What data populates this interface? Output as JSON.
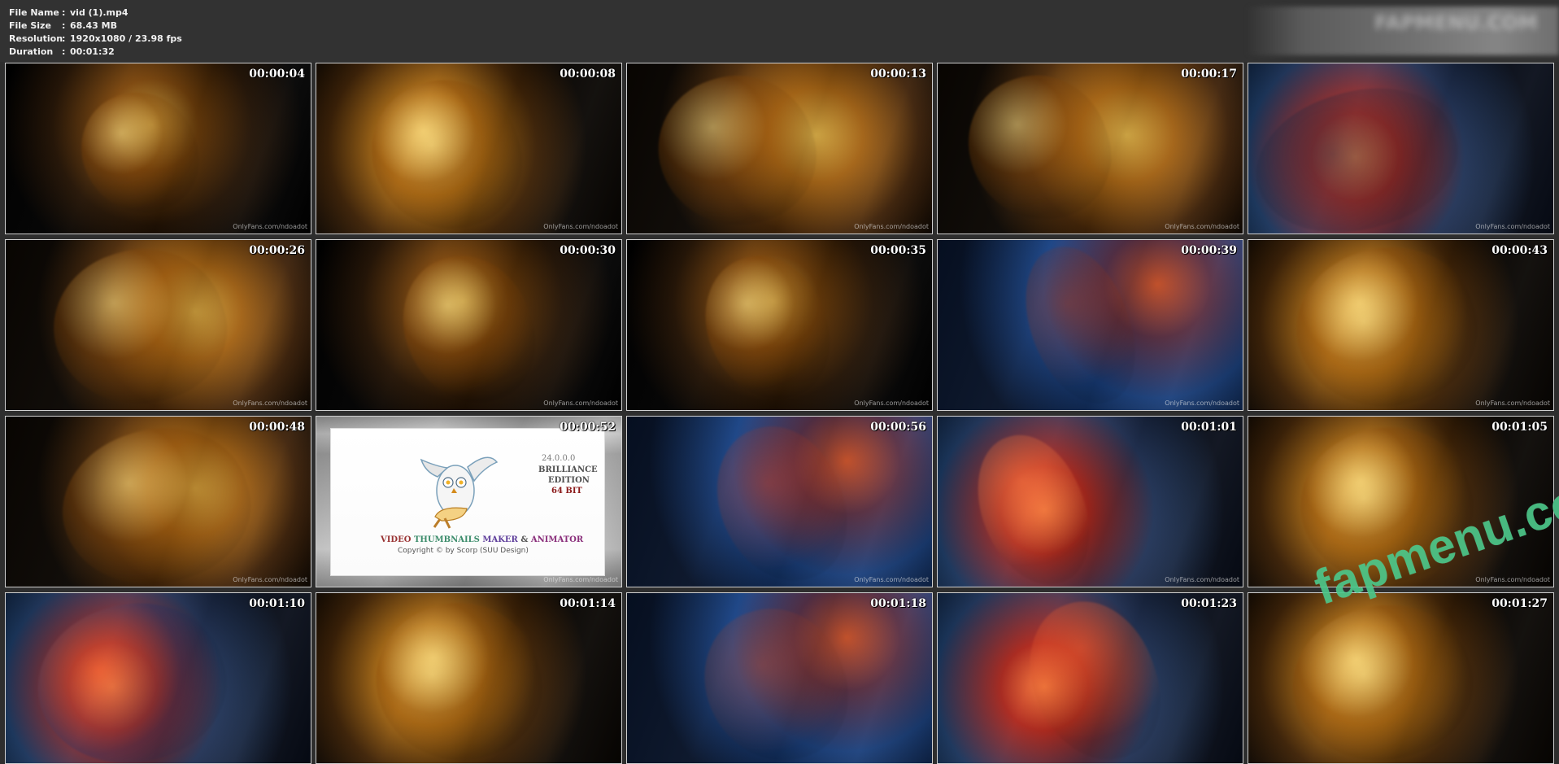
{
  "header": {
    "info": [
      {
        "label": "File Name",
        "sep": ":",
        "value": "vid (1).mp4"
      },
      {
        "label": "File Size",
        "sep": ":",
        "value": "68.43 MB"
      },
      {
        "label": "Resolution",
        "sep": ":",
        "value": "1920x1080 / 23.98 fps"
      },
      {
        "label": "Duration",
        "sep": ":",
        "value": "00:01:32"
      }
    ]
  },
  "thumbnails": [
    {
      "time": "00:00:04",
      "style": "dark",
      "watermark": "OnlyFans.com/ndoadot"
    },
    {
      "time": "00:00:08",
      "style": "warm2",
      "watermark": "OnlyFans.com/ndoadot"
    },
    {
      "time": "00:00:13",
      "style": "warm",
      "watermark": "OnlyFans.com/ndoadot"
    },
    {
      "time": "00:00:17",
      "style": "warm",
      "watermark": "OnlyFans.com/ndoadot"
    },
    {
      "time": "",
      "style": "red",
      "watermark": "OnlyFans.com/ndoadot"
    },
    {
      "time": "00:00:26",
      "style": "warm",
      "watermark": "OnlyFans.com/ndoadot"
    },
    {
      "time": "00:00:30",
      "style": "dark",
      "watermark": "OnlyFans.com/ndoadot"
    },
    {
      "time": "00:00:35",
      "style": "dark",
      "watermark": "OnlyFans.com/ndoadot"
    },
    {
      "time": "00:00:39",
      "style": "blue",
      "watermark": "OnlyFans.com/ndoadot"
    },
    {
      "time": "00:00:43",
      "style": "warm2",
      "watermark": "OnlyFans.com/ndoadot"
    },
    {
      "time": "00:00:48",
      "style": "warm",
      "watermark": "OnlyFans.com/ndoadot"
    },
    {
      "time": "00:00:52",
      "style": "splash",
      "watermark": "OnlyFans.com/ndoadot"
    },
    {
      "time": "00:00:56",
      "style": "blue",
      "watermark": "OnlyFans.com/ndoadot"
    },
    {
      "time": "00:01:01",
      "style": "red",
      "watermark": "OnlyFans.com/ndoadot"
    },
    {
      "time": "00:01:05",
      "style": "warm2",
      "watermark": "OnlyFans.com/ndoadot"
    },
    {
      "time": "00:01:10",
      "style": "red",
      "watermark": ""
    },
    {
      "time": "00:01:14",
      "style": "warm2",
      "watermark": ""
    },
    {
      "time": "00:01:18",
      "style": "blue",
      "watermark": ""
    },
    {
      "time": "00:01:23",
      "style": "red",
      "watermark": ""
    },
    {
      "time": "00:01:27",
      "style": "warm2",
      "watermark": ""
    }
  ],
  "splash": {
    "version": "24.0.0.0",
    "edition_line_1": "BRILLIANCE",
    "edition_line_2": "EDITION",
    "bit": "64 BIT",
    "title_part_1": "VIDEO ",
    "title_part_2": "THUMBNAILS ",
    "title_part_3": "MAKER ",
    "title_part_4": "& ",
    "title_part_5": "ANIMATOR",
    "copyright": "Copyright © by Scorp (SUU Design)"
  },
  "watermark_brand": "fapmenu.com",
  "top_right_blur": "FAPMENU.COM"
}
